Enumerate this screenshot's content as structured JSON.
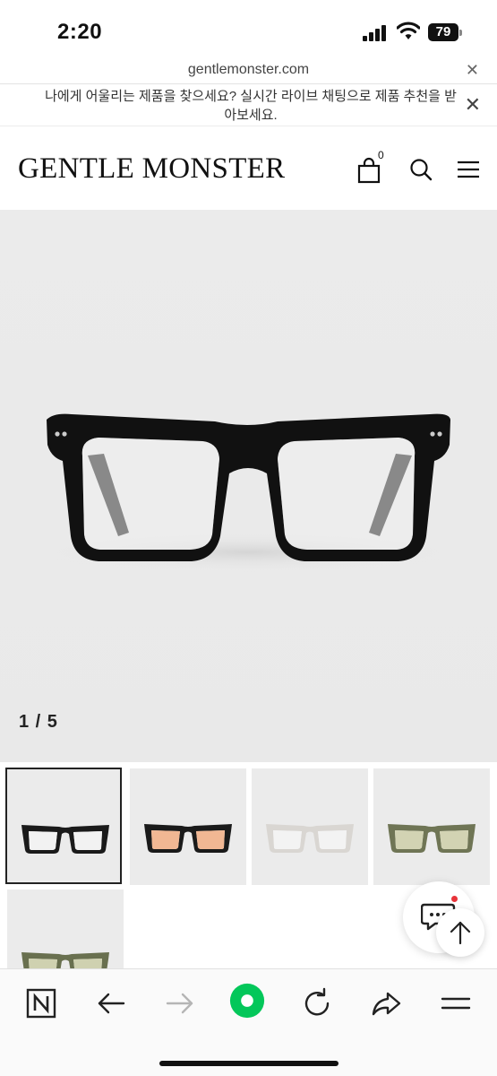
{
  "status_bar": {
    "time": "2:20",
    "battery": "79"
  },
  "browser": {
    "url": "gentlemonster.com"
  },
  "banner": {
    "text": "나에게 어울리는 제품을 찾으세요? 실시간 라이브 채팅으로 제품 추천을 받아보세요."
  },
  "header": {
    "logo": "GENTLE MONSTER",
    "cart_count": "0"
  },
  "product": {
    "slide_counter": "1 / 5"
  },
  "thumbnails": [
    {
      "variant": "black",
      "frame_color": "#1a1a1a",
      "lens_color": "#f2f2f2"
    },
    {
      "variant": "black-orange",
      "frame_color": "#1a1a1a",
      "lens_color": "#f1b793"
    },
    {
      "variant": "clear",
      "frame_color": "#d9d6d2",
      "lens_color": "#f3f3f3"
    },
    {
      "variant": "olive-green",
      "frame_color": "#6f7555",
      "lens_color": "#d2d3b3"
    },
    {
      "variant": "olive-partial",
      "frame_color": "#69704f",
      "lens_color": "#cfd1b0"
    }
  ],
  "colors": {
    "background": "#ebebeb",
    "chat_badge": "#e8333a",
    "naver_green": "#03c75a"
  }
}
